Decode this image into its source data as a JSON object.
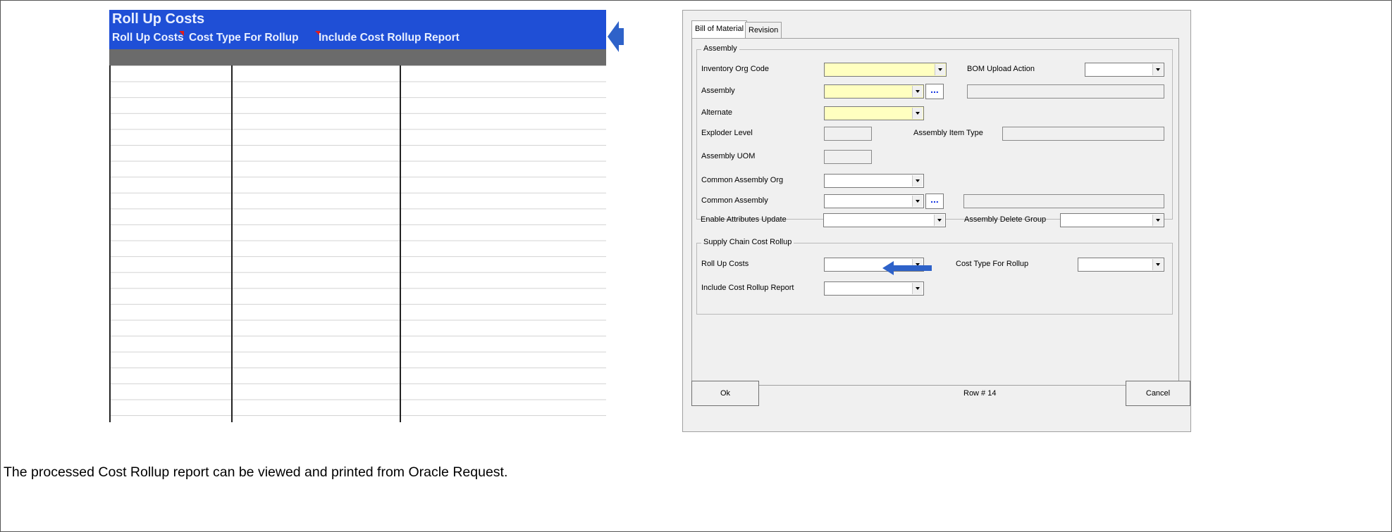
{
  "sheet": {
    "title": "Roll Up Costs",
    "columns": [
      "Roll Up Costs",
      "Cost Type For Rollup",
      "Include Cost Rollup Report"
    ],
    "header_color": "#1f4fd6"
  },
  "dialog": {
    "tabs": [
      "Bill of Material",
      "Revision"
    ],
    "assembly_group": {
      "label": "Assembly",
      "inventory_org_code": "Inventory Org Code",
      "bom_upload_action": "BOM Upload Action",
      "assembly": "Assembly",
      "alternate": "Alternate",
      "exploder_level": "Exploder Level",
      "assembly_item_type": "Assembly Item Type",
      "assembly_uom": "Assembly UOM",
      "common_assembly_org": "Common Assembly Org",
      "common_assembly": "Common Assembly",
      "enable_attributes_update": "Enable Attributes Update",
      "assembly_delete_group": "Assembly Delete Group"
    },
    "cost_group": {
      "label": "Supply Chain Cost Rollup",
      "roll_up_costs": "Roll Up Costs",
      "cost_type_for_rollup": "Cost Type For Rollup",
      "include_cost_rollup_report": "Include Cost Rollup Report"
    },
    "ok_label": "Ok",
    "row_status": "Row # 14",
    "cancel_label": "Cancel",
    "ellipsis": "...",
    "required_field_color": "#ffffc0"
  },
  "caption": "The processed Cost Rollup report can be viewed and printed from Oracle Request."
}
